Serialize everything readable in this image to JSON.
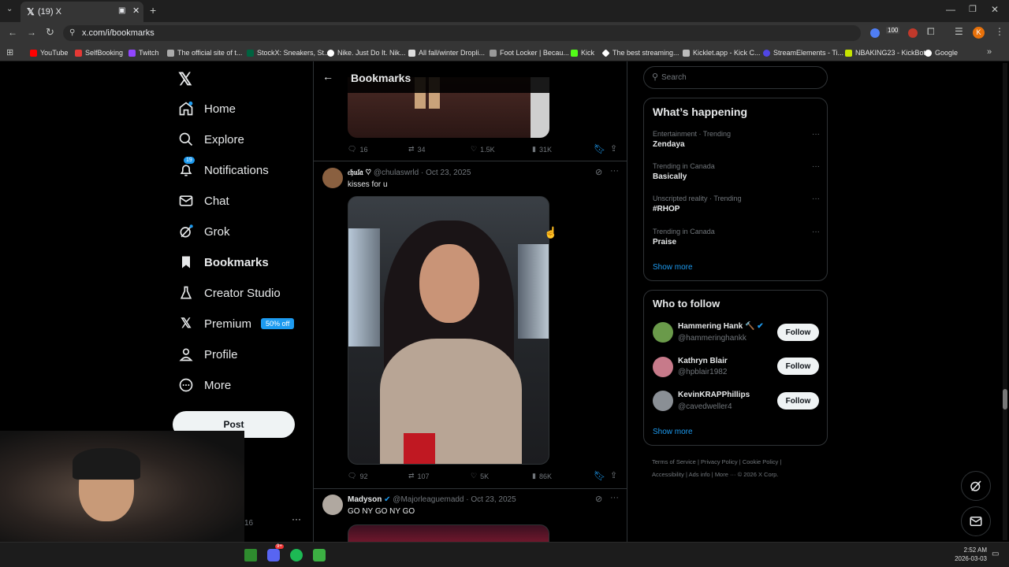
{
  "browser": {
    "tab_title": "(19) X",
    "url": "x.com/i/bookmarks",
    "bookmarks": [
      "YouTube",
      "SelfBooking",
      "Twitch",
      "The official site of t...",
      "StockX: Sneakers, St...",
      "Nike. Just Do It. Nik...",
      "All fall/winter Dropli...",
      "Foot Locker | Becau...",
      "Kick",
      "The best streaming...",
      "Kicklet.app - Kick C...",
      "StreamElements - Ti...",
      "NBAKING23 - KickBot",
      "Google"
    ],
    "ext_badge": "100"
  },
  "nav": {
    "items": [
      {
        "label": "Home",
        "icon": "home-icon"
      },
      {
        "label": "Explore",
        "icon": "search-icon"
      },
      {
        "label": "Notifications",
        "icon": "bell-icon",
        "badge": "19"
      },
      {
        "label": "Chat",
        "icon": "mail-icon"
      },
      {
        "label": "Grok",
        "icon": "grok-icon"
      },
      {
        "label": "Bookmarks",
        "icon": "bookmark-icon"
      },
      {
        "label": "Creator Studio",
        "icon": "flask-icon"
      },
      {
        "label": "Premium",
        "icon": "x-logo-icon",
        "badge": "50% off"
      },
      {
        "label": "Profile",
        "icon": "person-icon"
      },
      {
        "label": "More",
        "icon": "more-circle-icon"
      }
    ],
    "post_label": "Post",
    "account_suffix": "16",
    "account_more": "···"
  },
  "feed": {
    "header_title": "Bookmarks",
    "tweets": [
      {
        "replies": "16",
        "reposts": "34",
        "likes": "1.5K",
        "views": "31K"
      },
      {
        "name": "𝔠𝔥𝔲𝔩𝔞 ♡",
        "handle": "@chulaswrld",
        "date": "Oct 23, 2025",
        "text": "kisses for u",
        "replies": "92",
        "reposts": "107",
        "likes": "5K",
        "views": "86K"
      },
      {
        "name": "Madyson",
        "handle": "@Majorleaguemadd",
        "date": "Oct 23, 2025",
        "text": "GO NY GO NY GO"
      }
    ]
  },
  "sidebar": {
    "search_placeholder": "Search",
    "happening_title": "What’s happening",
    "trends": [
      {
        "meta": "Entertainment · Trending",
        "name": "Zendaya"
      },
      {
        "meta": "Trending in Canada",
        "name": "Basically"
      },
      {
        "meta": "Unscripted reality · Trending",
        "name": "#RHOP"
      },
      {
        "meta": "Trending in Canada",
        "name": "Praise"
      }
    ],
    "show_more": "Show more",
    "follow_title": "Who to follow",
    "follow": [
      {
        "name": "Hammering Hank 🔨",
        "handle": "@hammeringhankk"
      },
      {
        "name": "Kathryn Blair",
        "handle": "@hpblair1982"
      },
      {
        "name": "KevinKRAPPhillips",
        "handle": "@cavedweller4"
      }
    ],
    "follow_label": "Follow",
    "footer": [
      "Terms of Service",
      "|",
      "Privacy Policy",
      "|",
      "Cookie Policy",
      "|",
      "Accessibility",
      "|",
      "Ads info",
      "|",
      "More ···",
      "© 2026 X Corp."
    ]
  },
  "taskbar": {
    "time": "2:52 AM",
    "date": "2026-03-03",
    "discord_badge": "9+"
  },
  "colors": {
    "accent": "#1d9bf0",
    "bg": "#000000",
    "border": "#2f3336"
  }
}
